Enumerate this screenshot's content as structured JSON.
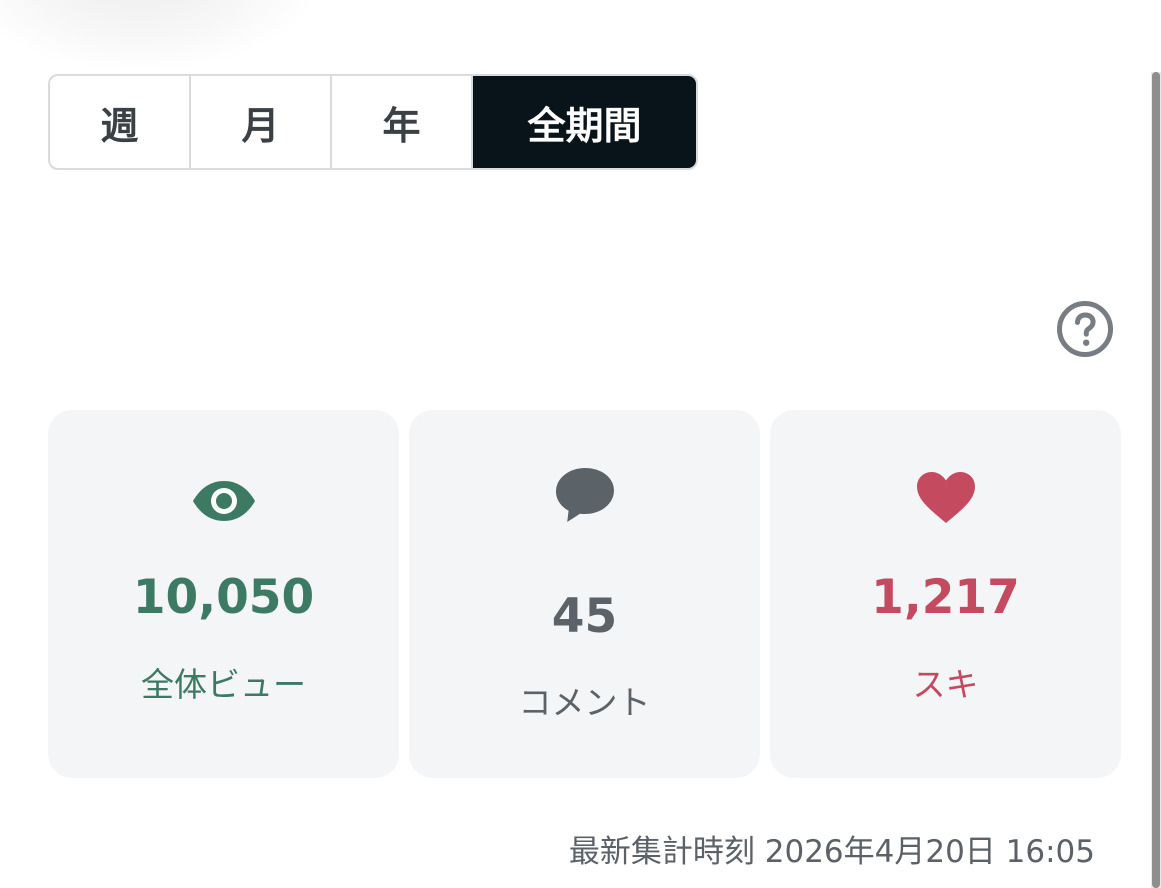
{
  "period_tabs": {
    "items": [
      "週",
      "月",
      "年",
      "全期間"
    ],
    "selected": "全期間"
  },
  "help": {
    "icon": "help-circle-icon"
  },
  "stats": [
    {
      "icon": "eye-icon",
      "value": "10,050",
      "label": "全体ビュー",
      "color": "#3c7a63"
    },
    {
      "icon": "comment-icon",
      "value": "45",
      "label": "コメント",
      "color": "#5c6368"
    },
    {
      "icon": "heart-icon",
      "value": "1,217",
      "label": "スキ",
      "color": "#c44a5f"
    }
  ],
  "updated_at": "最新集計時刻 2026年4月20日 16:05",
  "colors": {
    "selected_tab_bg": "#08131a",
    "card_bg": "#f4f5f7"
  }
}
